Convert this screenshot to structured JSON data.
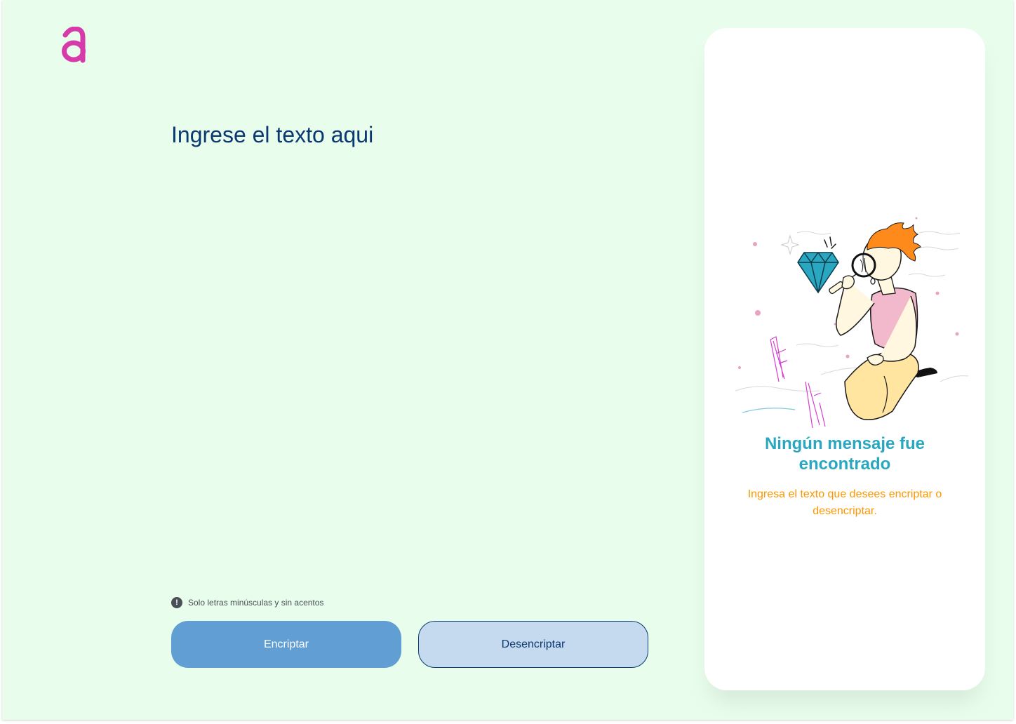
{
  "brand": {
    "logo_icon": "alura-a-logo-icon",
    "color": "#d63ba9"
  },
  "input": {
    "placeholder": "Ingrese el texto aqui",
    "value": ""
  },
  "hint": {
    "icon": "exclamation-circle-icon",
    "text": "Solo letras minúsculas y sin acentos"
  },
  "actions": {
    "encrypt_label": "Encriptar",
    "decrypt_label": "Desencriptar"
  },
  "output": {
    "illustration": "person-with-magnifying-glass-looking-at-diamond",
    "title": "Ningún mensaje fue encontrado",
    "subtitle": "Ingresa el texto que desees encriptar o desencriptar."
  },
  "colors": {
    "background": "#e8fdeb",
    "primary": "#0a3871",
    "encrypt_button": "#609ed4",
    "decrypt_button": "#c5daef",
    "title_accent": "#2aa7c0",
    "subtitle_accent": "#ff9500"
  }
}
